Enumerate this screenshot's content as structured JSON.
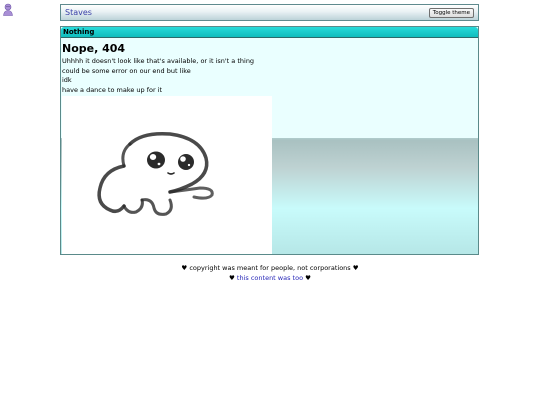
{
  "header": {
    "site_title": "Staves",
    "toggle_theme_label": "Toggle theme"
  },
  "panel": {
    "title": "Nothing",
    "heading": "Nope, 404",
    "lines": [
      "Uhhhh it doesn't look like that's available, or it isn't a thing",
      "could be some error on our end but like",
      "idk",
      "have a dance to make up for it"
    ],
    "image_subject": "dancing-creature-gif"
  },
  "footer": {
    "line1": "♥ copyright was meant for people, not corporations ♥",
    "line2_prefix": "♥",
    "line2_link": "this content was too",
    "line2_suffix": "♥"
  },
  "colors": {
    "panel_header": "#19cccc",
    "panel_bg_light": "#eaffff",
    "panel_bg_mid": "#c9fbfb",
    "panel_bg_dark": "#a9c1c1",
    "link": "#2727b8",
    "site_title": "#3a40a8"
  }
}
